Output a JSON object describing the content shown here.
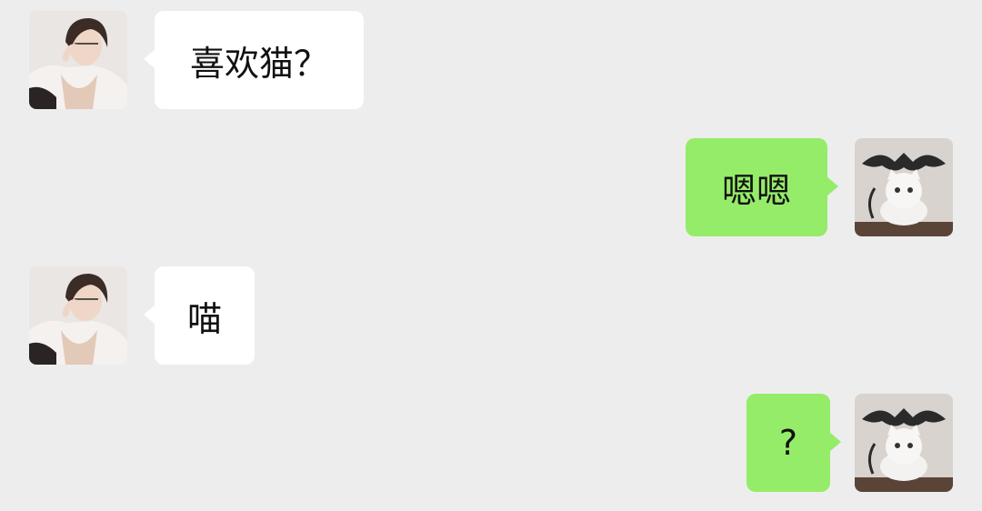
{
  "theme": {
    "background": "#ededed",
    "incoming_bubble": "#ffffff",
    "outgoing_bubble": "#95ec69"
  },
  "contact": {
    "avatar_icon": "anime-man-avatar-icon"
  },
  "me": {
    "avatar_icon": "white-cat-devil-avatar-icon"
  },
  "messages": [
    {
      "sender": "contact",
      "text": "喜欢猫？"
    },
    {
      "sender": "me",
      "text": "嗯嗯"
    },
    {
      "sender": "contact",
      "text": "喵"
    },
    {
      "sender": "me",
      "text": "?"
    }
  ]
}
